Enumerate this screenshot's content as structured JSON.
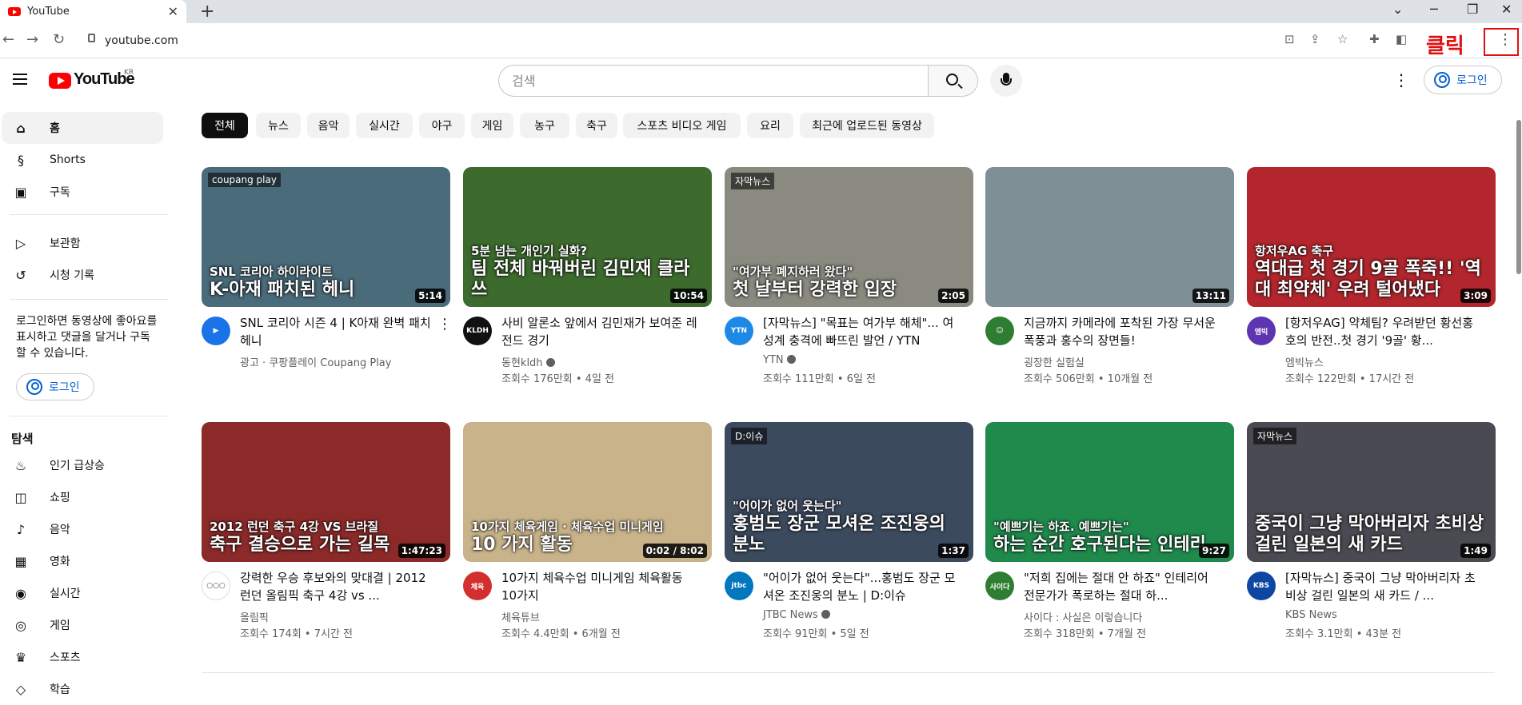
{
  "browser": {
    "tab_title": "YouTube",
    "tab_close": "✕",
    "new_tab": "+",
    "url": "youtube.com",
    "annotation_label": "클릭",
    "menu_glyph": "⋮",
    "window_controls": [
      "⌄",
      "─",
      "❐",
      "✕"
    ]
  },
  "masthead": {
    "logo_text": "YouTube",
    "logo_region": "KR",
    "search_placeholder": "검색",
    "login_label": "로그인",
    "more_glyph": "⋮"
  },
  "sidebar": {
    "items": [
      {
        "icon": "⌂",
        "icon_name": "home-icon",
        "label": "홈"
      },
      {
        "icon": "§",
        "icon_name": "shorts-icon",
        "label": "Shorts"
      },
      {
        "icon": "▣",
        "icon_name": "subscriptions-icon",
        "label": "구독"
      }
    ],
    "library": [
      {
        "icon": "▷",
        "icon_name": "library-icon",
        "label": "보관함"
      },
      {
        "icon": "↺",
        "icon_name": "history-icon",
        "label": "시청 기록"
      }
    ],
    "note": "로그인하면 동영상에 좋아요를 표시하고 댓글을 달거나 구독할 수 있습니다.",
    "login_label": "로그인",
    "explore_heading": "탐색",
    "explore": [
      {
        "icon": "♨",
        "icon_name": "trending-icon",
        "label": "인기 급상승"
      },
      {
        "icon": "◫",
        "icon_name": "shopping-icon",
        "label": "쇼핑"
      },
      {
        "icon": "♪",
        "icon_name": "music-icon",
        "label": "음악"
      },
      {
        "icon": "▦",
        "icon_name": "movies-icon",
        "label": "영화"
      },
      {
        "icon": "◉",
        "icon_name": "live-icon",
        "label": "실시간"
      },
      {
        "icon": "◎",
        "icon_name": "gaming-icon",
        "label": "게임"
      },
      {
        "icon": "♛",
        "icon_name": "sports-icon",
        "label": "스포츠"
      },
      {
        "icon": "◇",
        "icon_name": "learning-icon",
        "label": "학습"
      }
    ]
  },
  "chips": [
    "전체",
    "뉴스",
    "음악",
    "실시간",
    "야구",
    "게임",
    "농구",
    "축구",
    "스포츠 비디오 게임",
    "요리",
    "최근에 업로드된 동영상"
  ],
  "videos": [
    {
      "title": "SNL 코리아 시즌 4 | K아재 완벽 패치 헤니",
      "channel": "광고 · 쿠팡플레이 Coupang Play",
      "meta": "",
      "duration": "5:14",
      "overlay": "K-아재 패치된 헤니",
      "overlay_sub": "SNL 코리아 하이라이트",
      "tag": "coupang play",
      "avatar": "▶",
      "avatar_color": "#1a73e8",
      "thumb_bg": "#4a6b7a",
      "more": "⋮"
    },
    {
      "title": "사비 알론소 앞에서 김민재가 보여준 레전드 경기",
      "channel": "동현kldh",
      "meta": "조회수 176만회 • 4일 전",
      "duration": "10:54",
      "overlay": "팀 전체 바꿔버린 김민재 클라쓰",
      "overlay_sub": "5분 넘는 개인기 실화?",
      "tag": "",
      "avatar": "KLDH",
      "avatar_color": "#111111",
      "thumb_bg": "#3d6b2e",
      "verified": true
    },
    {
      "title": "[자막뉴스] \"목표는 여가부 해체\"... 여성계 충격에 빠뜨린 발언 / YTN",
      "channel": "YTN",
      "meta": "조회수 111만회 • 6일 전",
      "duration": "2:05",
      "overlay": "첫 날부터 강력한 입장",
      "overlay_sub": "\"여가부 폐지하러 왔다\"",
      "tag": "자막뉴스",
      "avatar": "YTN",
      "avatar_color": "#1e88e5",
      "thumb_bg": "#8a8a80",
      "verified": true
    },
    {
      "title": "지금까지 카메라에 포착된 가장 무서운 폭풍과 홍수의 장면들!",
      "channel": "굉장한 실험실",
      "meta": "조회수 506만회 • 10개월 전",
      "duration": "13:11",
      "overlay": "",
      "overlay_sub": "",
      "tag": "",
      "avatar": "☺",
      "avatar_color": "#2e7d32",
      "thumb_bg": "#7f8f96"
    },
    {
      "title": "[항저우AG] 약체팀? 우려받던 황선홍호의 반전..첫 경기 '9골' 황...",
      "channel": "엠빅뉴스",
      "meta": "조회수 122만회 • 17시간 전",
      "duration": "3:09",
      "overlay": "역대급 첫 경기 9골 폭죽!! '역대 최약체' 우려 털어냈다",
      "overlay_sub": "항저우AG 축구",
      "tag": "",
      "avatar": "엠빅",
      "avatar_color": "#5e35b1",
      "thumb_bg": "#b3262d"
    },
    {
      "title": "강력한 우승 후보와의 맞대결 | 2012 런던 올림픽 축구 4강 vs ...",
      "channel": "올림픽",
      "meta": "조회수 174회 • 7시간 전",
      "duration": "1:47:23",
      "overlay": "축구 결승으로 가는 길목",
      "overlay_sub": "2012 런던 축구 4강 VS 브라질",
      "tag": "",
      "avatar": "○○○",
      "avatar_color": "#ffffff",
      "thumb_bg": "#8c2a2a"
    },
    {
      "title": "10가지 체육수업 미니게임 체육활동 10가지",
      "channel": "체육튜브",
      "meta": "조회수 4.4만회 • 6개월 전",
      "duration": "0:02 / 8:02",
      "overlay": "10 가지 활동",
      "overlay_sub": "10가지 체육게임 · 체육수업 미니게임",
      "tag": "",
      "avatar": "체육",
      "avatar_color": "#d32f2f",
      "thumb_bg": "#c9b38a"
    },
    {
      "title": "\"어이가 없어 웃는다\"...홍범도 장군 모셔온 조진웅의 분노 | D:이슈",
      "channel": "JTBC News",
      "meta": "조회수 91만회 • 5일 전",
      "duration": "1:37",
      "overlay": "홍범도 장군 모셔온 조진웅의 분노",
      "overlay_sub": "\"어이가 없어 웃는다\"",
      "tag": "D:이슈",
      "avatar": "jtbc",
      "avatar_color": "#0277bd",
      "thumb_bg": "#3c4a5e",
      "verified": true
    },
    {
      "title": "\"저희 집에는 절대 안 하죠\" 인테리어 전문가가 폭로하는 절대 하...",
      "channel": "사이다 : 사실은 이렇습니다",
      "meta": "조회수 318만회 • 7개월 전",
      "duration": "9:27",
      "overlay": "하는 순간 호구된다는 인테리",
      "overlay_sub": "\"예쁘기는 하죠. 예쁘기는\"",
      "tag": "",
      "avatar": "사이다",
      "avatar_color": "#2e7d32",
      "thumb_bg": "#1f8a4c"
    },
    {
      "title": "[자막뉴스] 중국이 그냥 막아버리자 초비상 걸린 일본의 새 카드 / ...",
      "channel": "KBS News",
      "meta": "조회수 3.1만회 • 43분 전",
      "duration": "1:49",
      "overlay": "중국이 그냥 막아버리자 초비상 걸린 일본의 새 카드",
      "overlay_sub": "",
      "tag": "자막뉴스",
      "avatar": "KBS",
      "avatar_color": "#0d47a1",
      "thumb_bg": "#4a4a52"
    }
  ]
}
